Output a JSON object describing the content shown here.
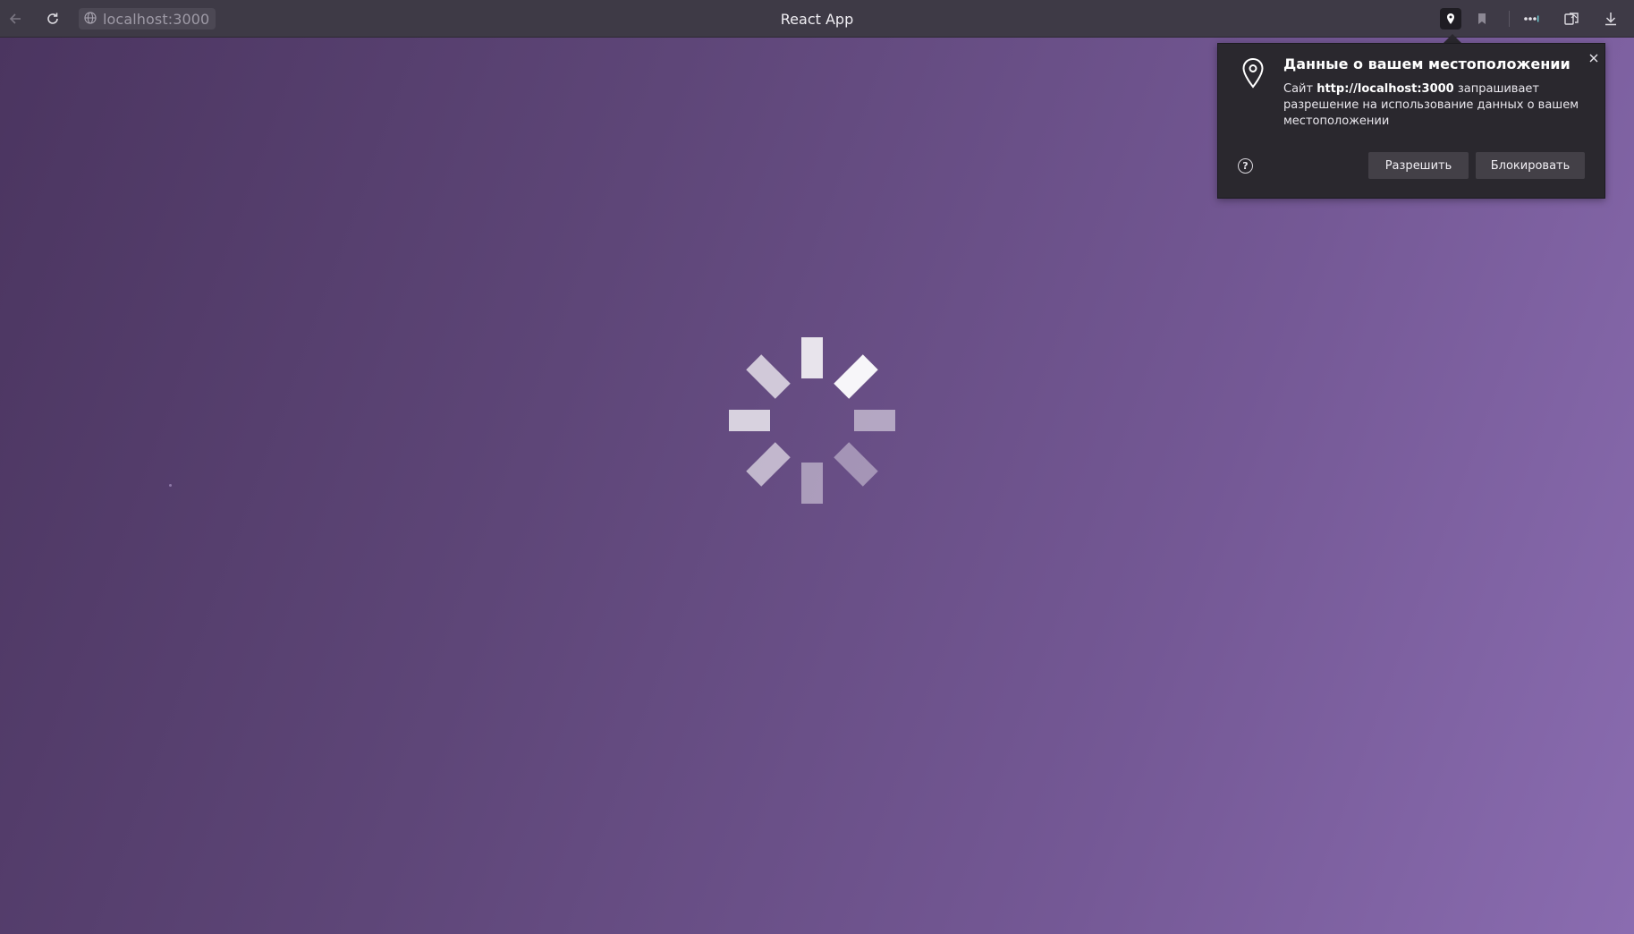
{
  "toolbar": {
    "url": "localhost:3000",
    "window_title": "React App",
    "icons": [
      "back-arrow-icon",
      "reload-icon",
      "globe-icon",
      "location-pin-icon",
      "bookmark-icon",
      "extensions-icon",
      "share-icon",
      "download-icon"
    ]
  },
  "popup": {
    "title": "Данные о вашем местоположении",
    "body_prefix": "Сайт ",
    "body_site": "http://localhost:3000",
    "body_suffix": " запрашивает разрешение на использование данных о вашем местоположении",
    "help_glyph": "?",
    "allow_label": "Разрешить",
    "block_label": "Блокировать"
  },
  "spinner": {
    "state": "loading",
    "segment_opacities": [
      0.7,
      0.85,
      0.95,
      0.5,
      0.4,
      0.45,
      0.6,
      0.75
    ]
  },
  "colors": {
    "toolbar_bg": "#3e3a46",
    "popup_bg": "#2a282e",
    "page_gradient_start": "#4b3560",
    "page_gradient_end": "#8a6cb0"
  }
}
